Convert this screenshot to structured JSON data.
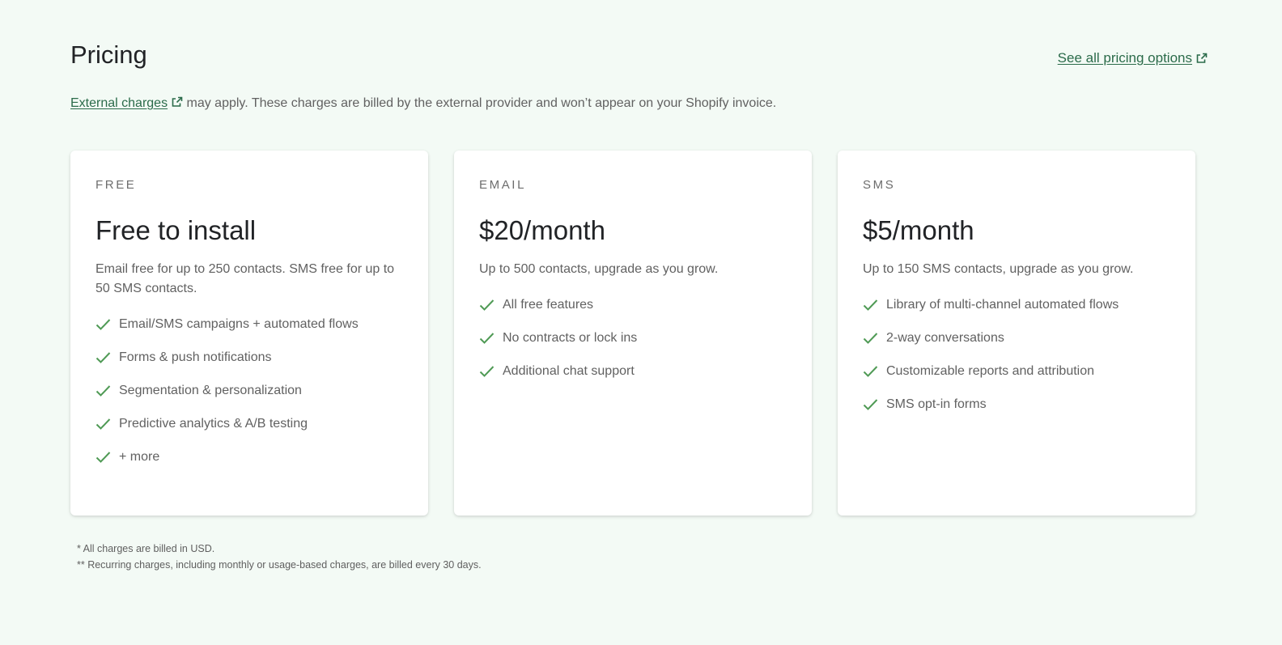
{
  "header": {
    "title": "Pricing",
    "all_options_link": "See all pricing options"
  },
  "charges_note": {
    "link_text": "External charges",
    "text": " may apply. These charges are billed by the external provider and won’t appear on your Shopify invoice."
  },
  "plans": [
    {
      "label": "FREE",
      "price": "Free to install",
      "description": "Email free for up to 250 contacts. SMS free for up to 50 SMS contacts.",
      "features": [
        "Email/SMS campaigns + automated flows",
        "Forms & push notifications",
        "Segmentation & personalization",
        "Predictive analytics & A/B testing",
        "+ more"
      ]
    },
    {
      "label": "EMAIL",
      "price": "$20/month",
      "description": "Up to 500 contacts, upgrade as you grow.",
      "features": [
        "All free features",
        "No contracts or lock ins",
        "Additional chat support"
      ]
    },
    {
      "label": "SMS",
      "price": "$5/month",
      "description": "Up to 150 SMS contacts, upgrade as you grow.",
      "features": [
        "Library of multi-channel automated flows",
        "2-way conversations",
        "Customizable reports and attribution",
        "SMS opt-in forms"
      ]
    }
  ],
  "footnotes": [
    "* All charges are billed in USD.",
    "** Recurring charges, including monthly or usage-based charges, are billed every 30 days."
  ],
  "icons": {
    "check": "check-icon",
    "external": "external-link-icon"
  },
  "colors": {
    "background": "#f3faf5",
    "link": "#2b6b4a",
    "check": "#4f9a55",
    "card": "#ffffff"
  }
}
